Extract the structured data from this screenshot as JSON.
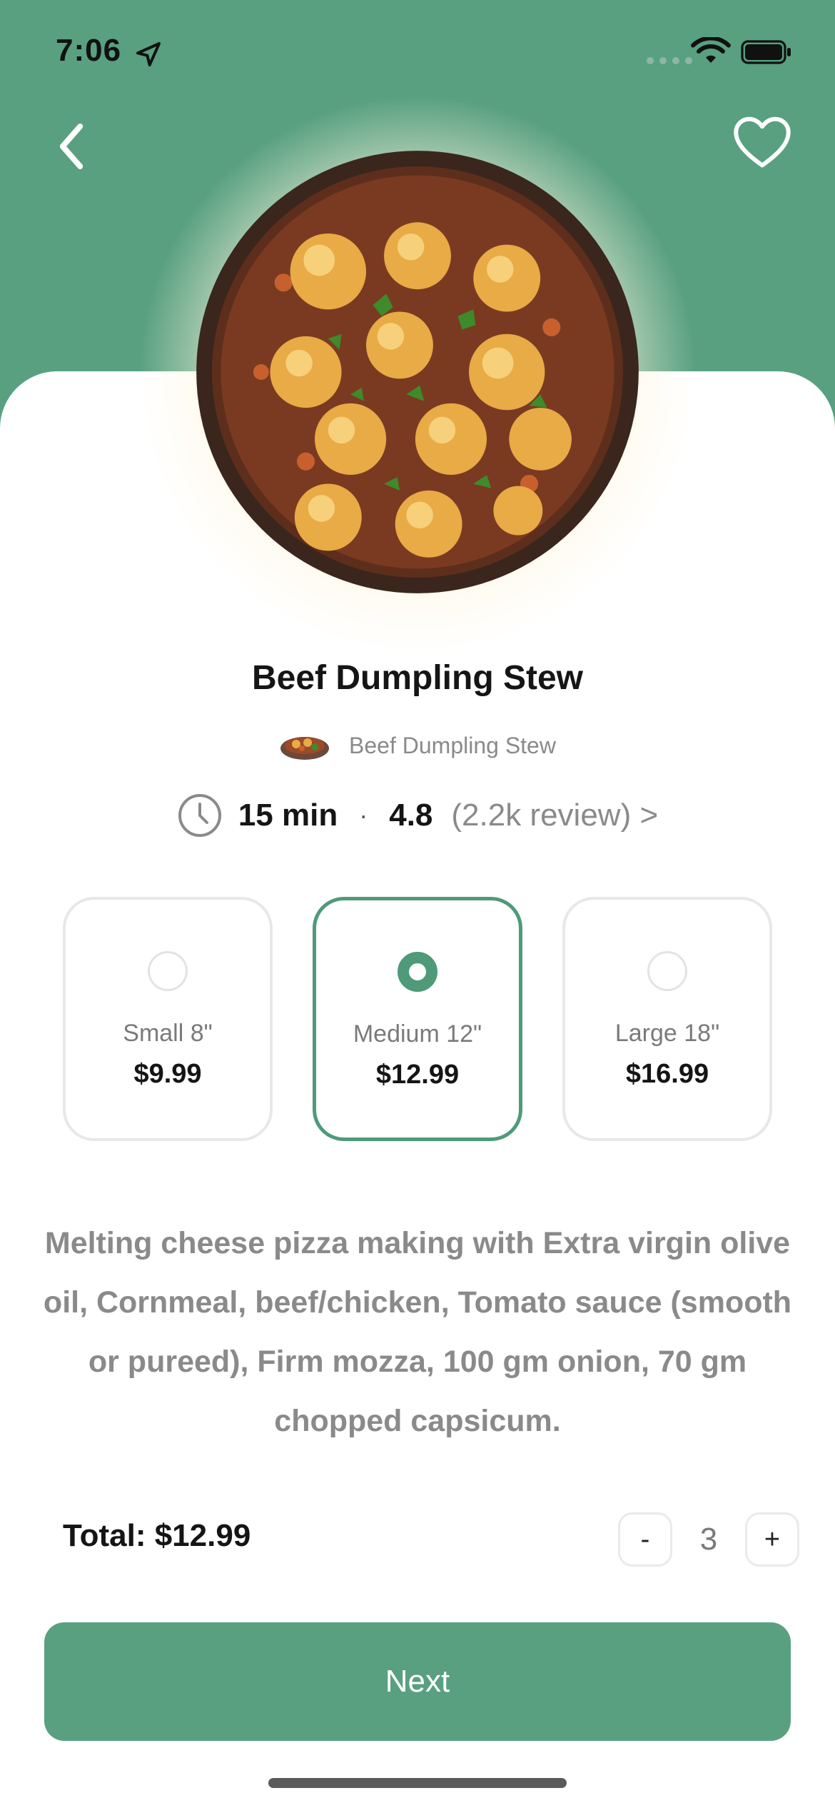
{
  "status_bar": {
    "time": "7:06"
  },
  "icons": {
    "location": "location-arrow-icon",
    "wifi": "wifi-icon",
    "battery": "battery-icon",
    "back": "chevron-left-icon",
    "favorite": "heart-outline-icon",
    "clock": "clock-icon",
    "review_arrow": "chevron-right"
  },
  "colors": {
    "accent": "#58a080",
    "text_primary": "#151515",
    "text_secondary": "#8a8a8a"
  },
  "product": {
    "title": "Beef Dumpling Stew",
    "subtitle": "Beef Dumpling Stew",
    "time": "15 min",
    "separator": "·",
    "rating": "4.8",
    "reviews": "(2.2k review) >"
  },
  "sizes": [
    {
      "name": "Small 8\"",
      "price": "$9.99",
      "selected": false
    },
    {
      "name": "Medium 12\"",
      "price": "$12.99",
      "selected": true
    },
    {
      "name": "Large 18\"",
      "price": "$16.99",
      "selected": false
    }
  ],
  "description": "Melting cheese pizza making with Extra virgin olive oil, Cornmeal, beef/chicken, Tomato sauce (smooth or pureed), Firm mozza, 100 gm onion, 70 gm chopped capsicum.",
  "order": {
    "total": "Total: $12.99",
    "decrement_label": "-",
    "quantity": "3",
    "increment_label": "+"
  },
  "next_button": {
    "label": "Next"
  }
}
